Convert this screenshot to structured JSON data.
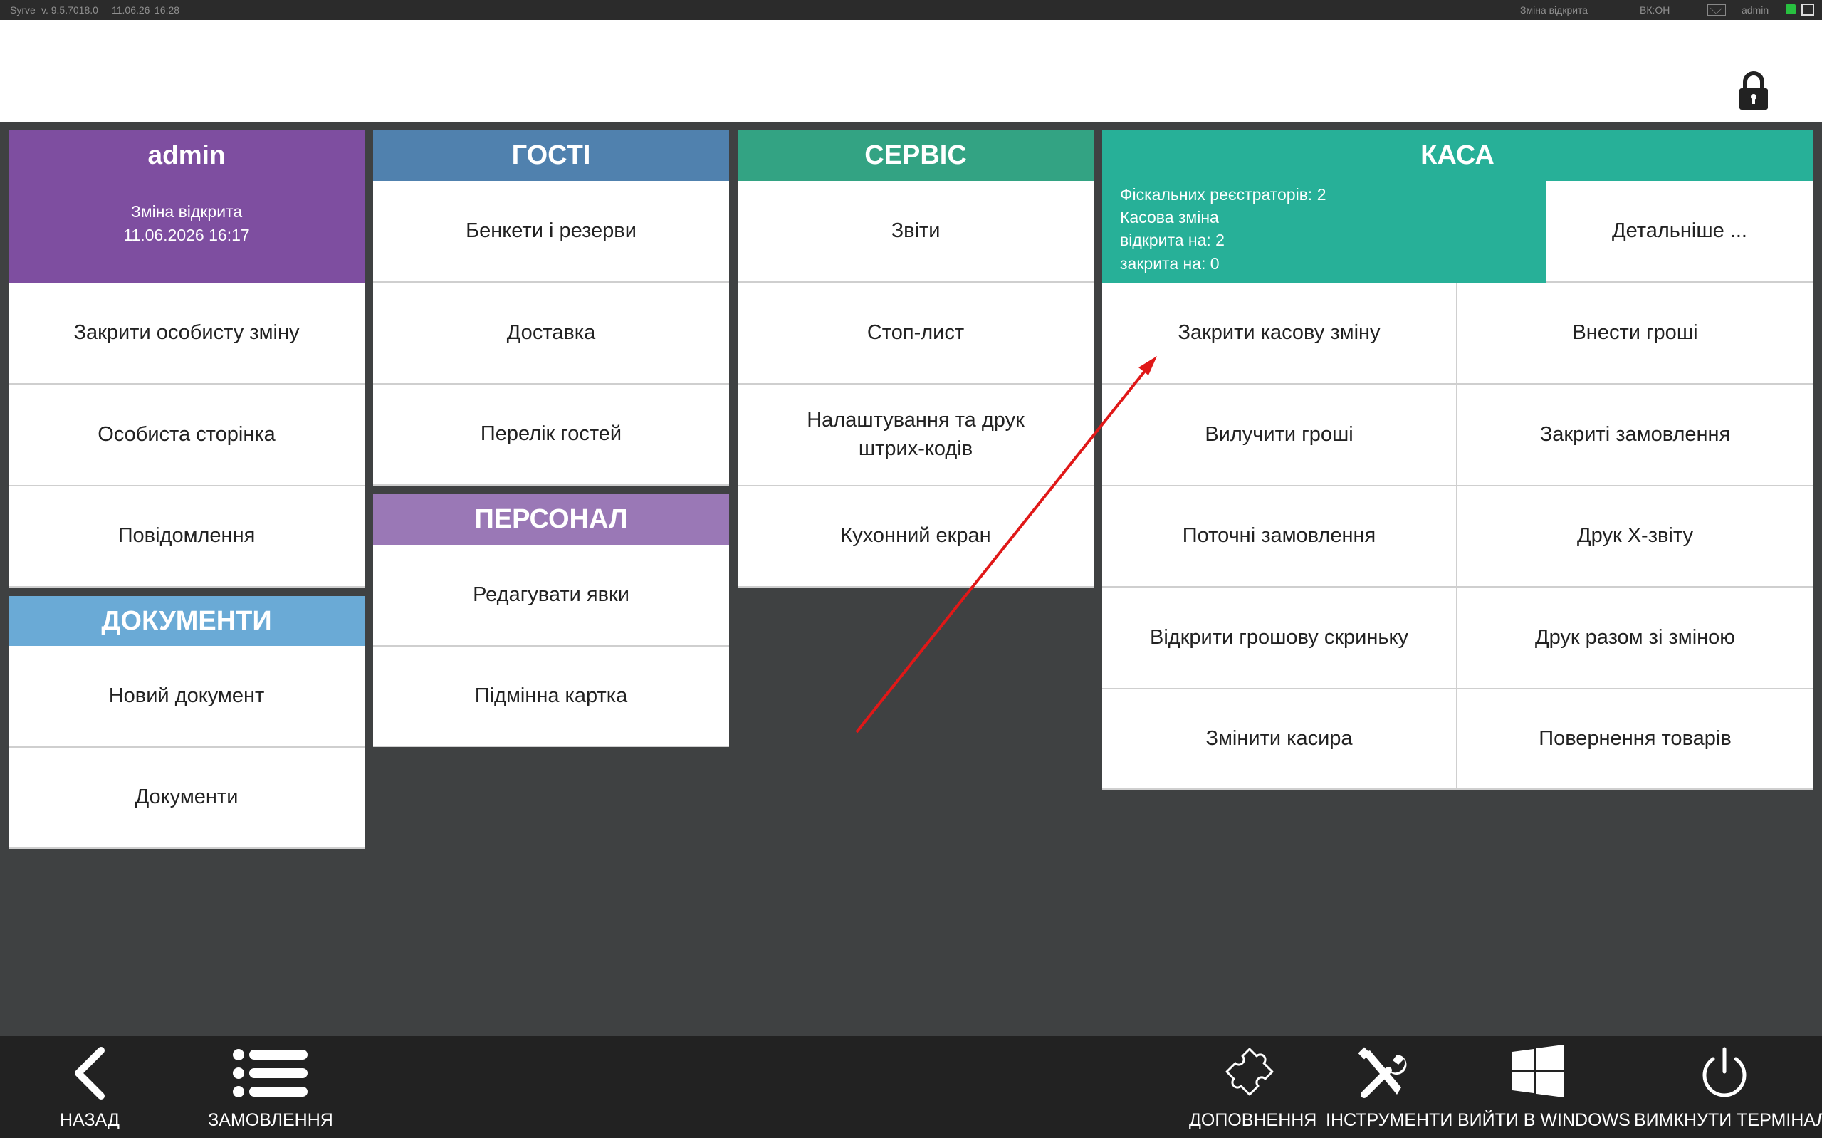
{
  "status_bar": {
    "brand": "Syrve",
    "version": "v. 9.5.7018.0",
    "date": "11.06.26",
    "time": "16:28",
    "shift_status": "Зміна відкрита",
    "indicator": "ВК:ОН",
    "user": "admin"
  },
  "user_panel": {
    "name": "admin",
    "shift_label": "Зміна відкрита",
    "shift_time": "11.06.2026 16:17",
    "items": [
      "Закрити особисту зміну",
      "Особиста сторінка",
      "Повідомлення"
    ]
  },
  "documents": {
    "title": "ДОКУМЕНТИ",
    "items": [
      "Новий документ",
      "Документи"
    ]
  },
  "guests": {
    "title": "ГОСТІ",
    "items": [
      "Бенкети і резерви",
      "Доставка",
      "Перелік гостей"
    ]
  },
  "staff": {
    "title": "ПЕРСОНАЛ",
    "items": [
      "Редагувати явки",
      "Підмінна картка"
    ]
  },
  "service": {
    "title": "СЕРВІС",
    "items": [
      "Звіти",
      "Стоп-лист",
      "Налаштування та друк штрих-кодів",
      "Кухонний екран"
    ]
  },
  "cash": {
    "title": "КАСА",
    "info": [
      "Фіскальних реєстраторів: 2",
      "Касова зміна",
      "відкрита на: 2",
      "закрита на: 0"
    ],
    "details": "Детальніше ...",
    "left_items": [
      "Закрити касову зміну",
      "Вилучити гроші",
      "Поточні замовлення",
      "Відкрити грошову скриньку",
      "Змінити касира"
    ],
    "right_items": [
      "Внести гроші",
      "Закриті замовлення",
      "Друк Х-звіту",
      "Друк разом зі зміною",
      "Повернення товарів"
    ]
  },
  "bottom_bar": {
    "back": "НАЗАД",
    "orders": "ЗАМОВЛЕННЯ",
    "addons": "ДОПОВНЕННЯ",
    "tools": "ІНСТРУМЕНТИ",
    "windows": "ВИЙТИ В WINDOWS",
    "shutdown": "ВИМКНУТИ ТЕРМІНАЛ"
  },
  "colors": {
    "admin": "#7e4ea0",
    "documents": "#6aaad6",
    "guests": "#5081ae",
    "staff": "#9a78b6",
    "service": "#33a383",
    "cash": "#27b098",
    "background": "#3f4142",
    "annotation_arrow": "#e01818"
  }
}
